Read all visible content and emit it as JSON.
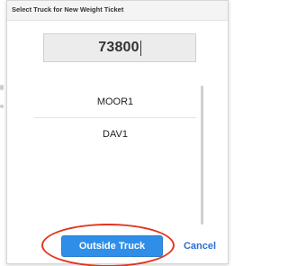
{
  "dialog": {
    "title": "Select Truck for New Weight Ticket"
  },
  "number_field": {
    "value": "73800"
  },
  "truck_list": {
    "items": [
      {
        "label": "MOOR1"
      },
      {
        "label": "DAV1"
      }
    ]
  },
  "buttons": {
    "outside_truck_label": "Outside Truck",
    "cancel_label": "Cancel"
  },
  "colors": {
    "primary_button": "#2f8fe8",
    "highlight_oval": "#e1361d",
    "cancel_text": "#2a6fd6"
  },
  "annotations": {
    "highlight": "outside-truck-button"
  }
}
